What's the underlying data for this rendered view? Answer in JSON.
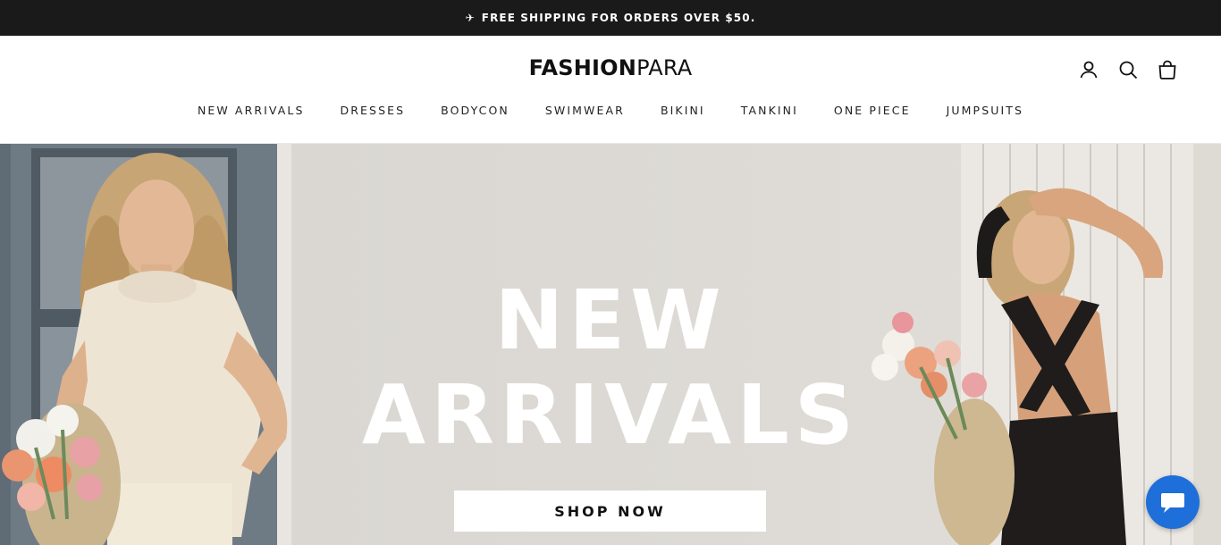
{
  "announcement": {
    "icon": "airplane-icon",
    "text": "FREE SHIPPING FOR ORDERS OVER $50."
  },
  "header": {
    "logo_bold": "FASHION",
    "logo_light": "PARA",
    "icons": [
      "account-icon",
      "search-icon",
      "cart-icon"
    ]
  },
  "nav": {
    "items": [
      {
        "label": "NEW ARRIVALS"
      },
      {
        "label": "DRESSES"
      },
      {
        "label": "BODYCON"
      },
      {
        "label": "SWIMWEAR"
      },
      {
        "label": "BIKINI"
      },
      {
        "label": "TANKINI"
      },
      {
        "label": "ONE PIECE"
      },
      {
        "label": "JUMPSUITS"
      }
    ]
  },
  "hero": {
    "title_line1": "NEW",
    "title_line2": "ARRIVALS",
    "cta_label": "SHOP NOW"
  },
  "chat": {
    "icon": "chat-bubble-icon",
    "color": "#1e6fd9"
  },
  "colors": {
    "announcement_bg": "#1a1a1a",
    "accent": "#1e6fd9"
  }
}
